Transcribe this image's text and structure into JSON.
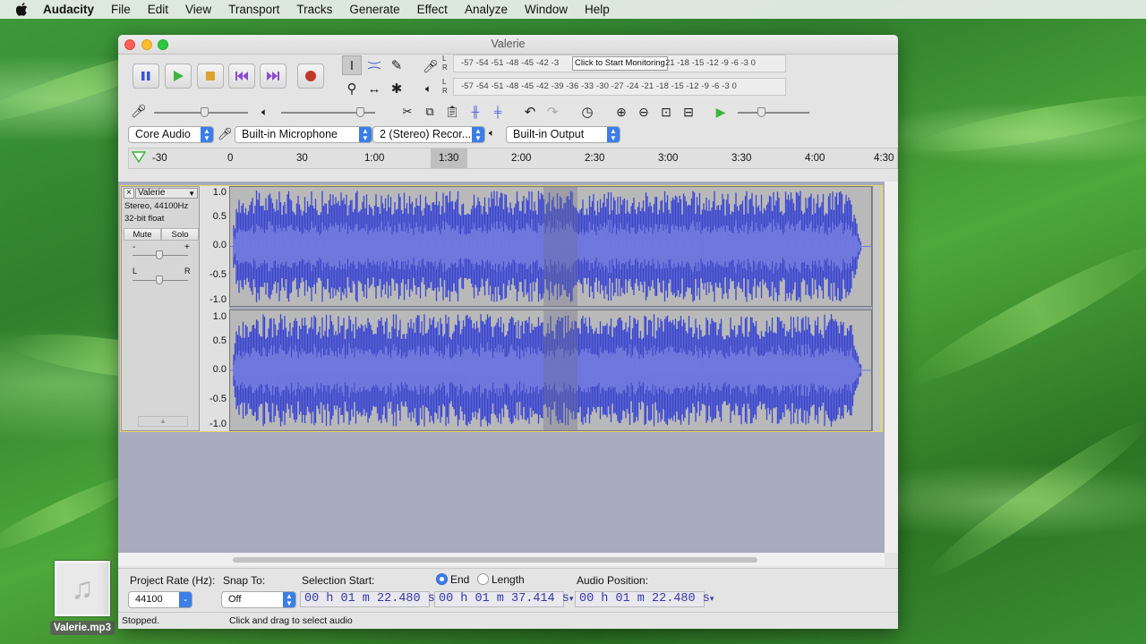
{
  "menubar": {
    "app": "Audacity",
    "items": [
      "File",
      "Edit",
      "View",
      "Transport",
      "Tracks",
      "Generate",
      "Effect",
      "Analyze",
      "Window",
      "Help"
    ]
  },
  "desktop": {
    "file_label": "Valerie.mp3"
  },
  "window": {
    "title": "Valerie"
  },
  "meters": {
    "record_scale": "-57 -54 -51 -48 -45 -42 -3",
    "record_hint": "Click to Start Monitoring",
    "record_scale_tail": "21 -18 -15 -12  -9  -6  -3  0",
    "playback_scale": "-57 -54 -51 -48 -45 -42 -39 -36 -33 -30 -27 -24 -21 -18 -15 -12  -9  -6  -3  0",
    "lr_top": "L",
    "lr_bottom": "R"
  },
  "devices": {
    "host": "Core Audio",
    "input": "Built-in Microphone",
    "channels": "2 (Stereo) Recor...",
    "output": "Built-in Output"
  },
  "ruler": {
    "ticks": [
      "-30",
      "0",
      "30",
      "1:00",
      "1:30",
      "2:00",
      "2:30",
      "3:00",
      "3:30",
      "4:00",
      "4:30"
    ]
  },
  "track": {
    "name": "Valerie",
    "info1": "Stereo, 44100Hz",
    "info2": "32-bit float",
    "mute": "Mute",
    "solo": "Solo",
    "gain_minus": "-",
    "gain_plus": "+",
    "pan_l": "L",
    "pan_r": "R",
    "scale": [
      "1.0",
      "0.5",
      "0.0",
      "-0.5",
      "-1.0"
    ]
  },
  "selection_bar": {
    "project_rate_label": "Project Rate (Hz):",
    "project_rate": "44100",
    "snap_label": "Snap To:",
    "snap_value": "Off",
    "sel_start_label": "Selection Start:",
    "end_label": "End",
    "length_label": "Length",
    "end_selected": true,
    "sel_start": "00 h 01 m 22.480 s",
    "sel_end": "00 h 01 m 37.414 s",
    "audio_pos_label": "Audio Position:",
    "audio_pos": "00 h 01 m 22.480 s"
  },
  "status": {
    "left": "Stopped.",
    "right": "Click and drag to select audio"
  },
  "colors": {
    "wave": "#3a46d0",
    "wave_rms": "#6f78e0",
    "accent": "#3b7de9",
    "record": "#c0382b",
    "play": "#3db53d"
  }
}
